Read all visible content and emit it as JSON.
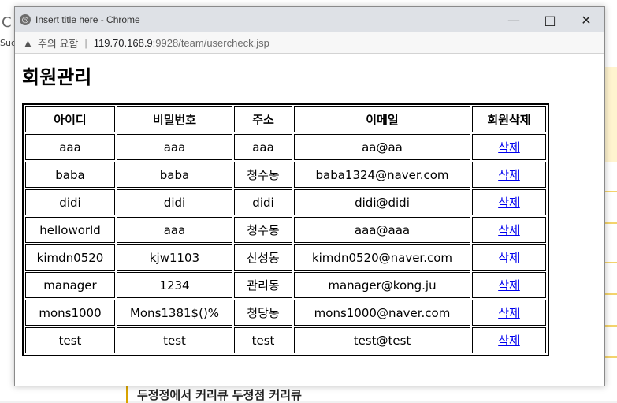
{
  "background": {
    "left_char": "C",
    "left_text": "Suc",
    "bottom_text": "두정정에서 커리큐 두정점 커리큐"
  },
  "window": {
    "title": "Insert title here - Chrome",
    "warning": "주의 요함",
    "url_host": "119.70.168.9",
    "url_path": ":9928/team/usercheck.jsp"
  },
  "page": {
    "heading": "회원관리",
    "table": {
      "headers": [
        "아이디",
        "비밀번호",
        "주소",
        "이메일",
        "회원삭제"
      ],
      "rows": [
        [
          "aaa",
          "aaa",
          "aaa",
          "aa@aa",
          "삭제"
        ],
        [
          "baba",
          "baba",
          "청수동",
          "baba1324@naver.com",
          "삭제"
        ],
        [
          "didi",
          "didi",
          "didi",
          "didi@didi",
          "삭제"
        ],
        [
          "helloworld",
          "aaa",
          "청수동",
          "aaa@aaa",
          "삭제"
        ],
        [
          "kimdn0520",
          "kjw1103",
          "산성동",
          "kimdn0520@naver.com",
          "삭제"
        ],
        [
          "manager",
          "1234",
          "관리동",
          "manager@kong.ju",
          "삭제"
        ],
        [
          "mons1000",
          "Mons1381$()%",
          "청당동",
          "mons1000@naver.com",
          "삭제"
        ],
        [
          "test",
          "test",
          "test",
          "test@test",
          "삭제"
        ]
      ]
    }
  }
}
